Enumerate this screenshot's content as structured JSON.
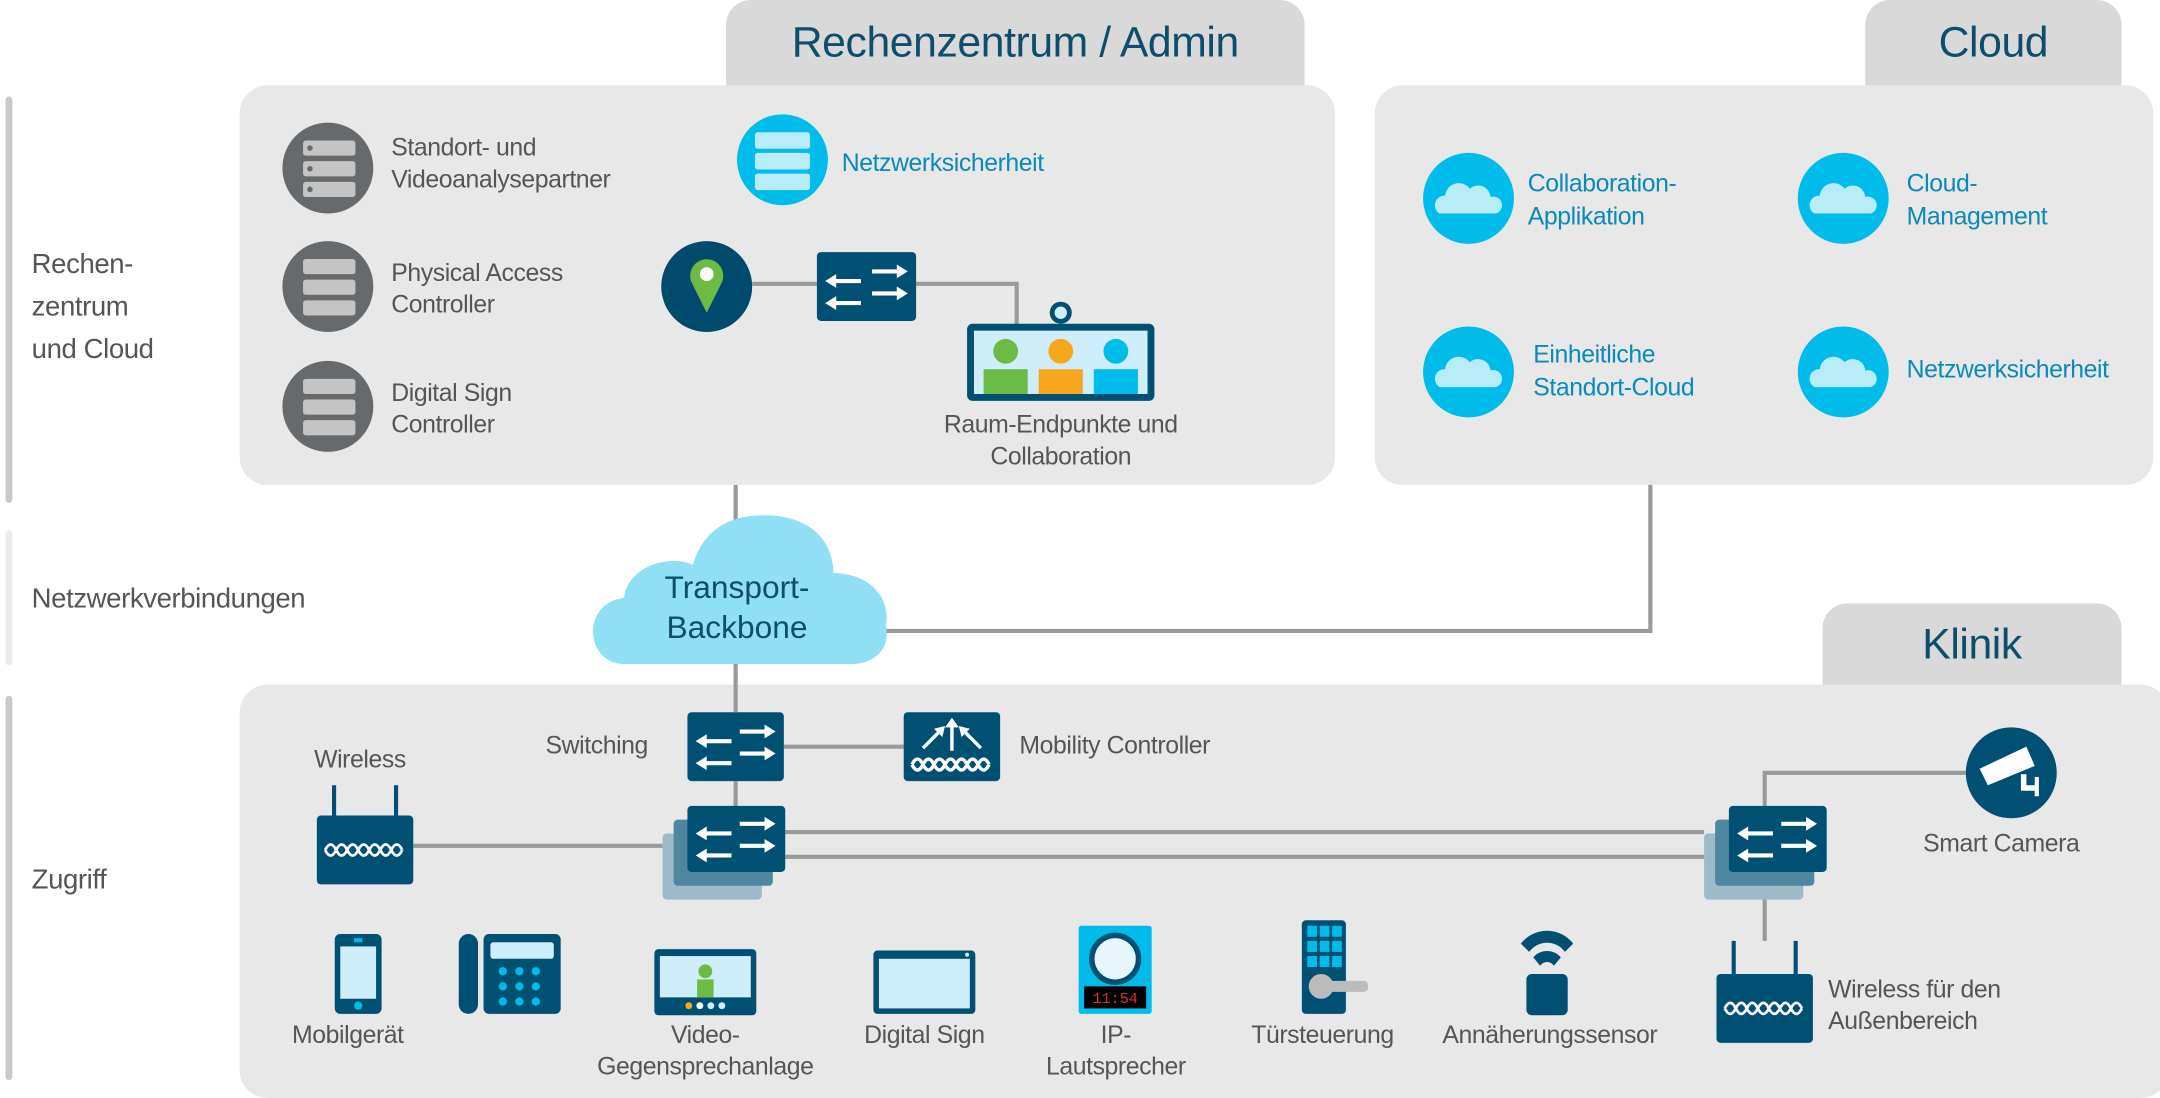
{
  "colors": {
    "dark_blue": "#005073",
    "cyan": "#00bceb",
    "gray_icon": "#666a6c",
    "panel": "#e8e8e8",
    "tab": "#d9d9d9",
    "line": "#999999",
    "green": "#6cbb45",
    "orange": "#f8a61c"
  },
  "sections": {
    "left": {
      "rechenzentrum": [
        "Rechen-",
        "zentrum",
        "und Cloud"
      ],
      "netz": "Netzwerkverbindungen",
      "zugriff": "Zugriff"
    },
    "tabs": {
      "admin": "Rechenzentrum / Admin",
      "cloud": "Cloud",
      "klinik": "Klinik"
    }
  },
  "admin": {
    "standort": [
      "Standort- und",
      "Videoanalysepartner"
    ],
    "pac": [
      "Physical Access",
      "Controller"
    ],
    "dsc": [
      "Digital Sign",
      "Controller"
    ],
    "netzsec": "Netzwerksicherheit",
    "raum": [
      "Raum-Endpunkte und",
      "Collaboration"
    ]
  },
  "cloud": {
    "collab": [
      "Collaboration-",
      "Applikation"
    ],
    "mgmt": [
      "Cloud-",
      "Management"
    ],
    "standort": [
      "Einheitliche",
      "Standort-Cloud"
    ],
    "netzsec": "Netzwerksicherheit"
  },
  "transport": [
    "Transport-",
    "Backbone"
  ],
  "klinik": {
    "wireless": "Wireless",
    "switching": "Switching",
    "mobility": "Mobility Controller",
    "camera": "Smart Camera",
    "outdoor": [
      "Wireless für den",
      "Außenbereich"
    ],
    "devices": {
      "mobil": "Mobilgerät",
      "video": [
        "Video-",
        "Gegensprechanlage"
      ],
      "sign": "Digital Sign",
      "ip": [
        "IP-",
        "Lautsprecher"
      ],
      "clock": "11:54",
      "tuer": "Türsteuerung",
      "sensor": "Annäherungssensor"
    }
  }
}
